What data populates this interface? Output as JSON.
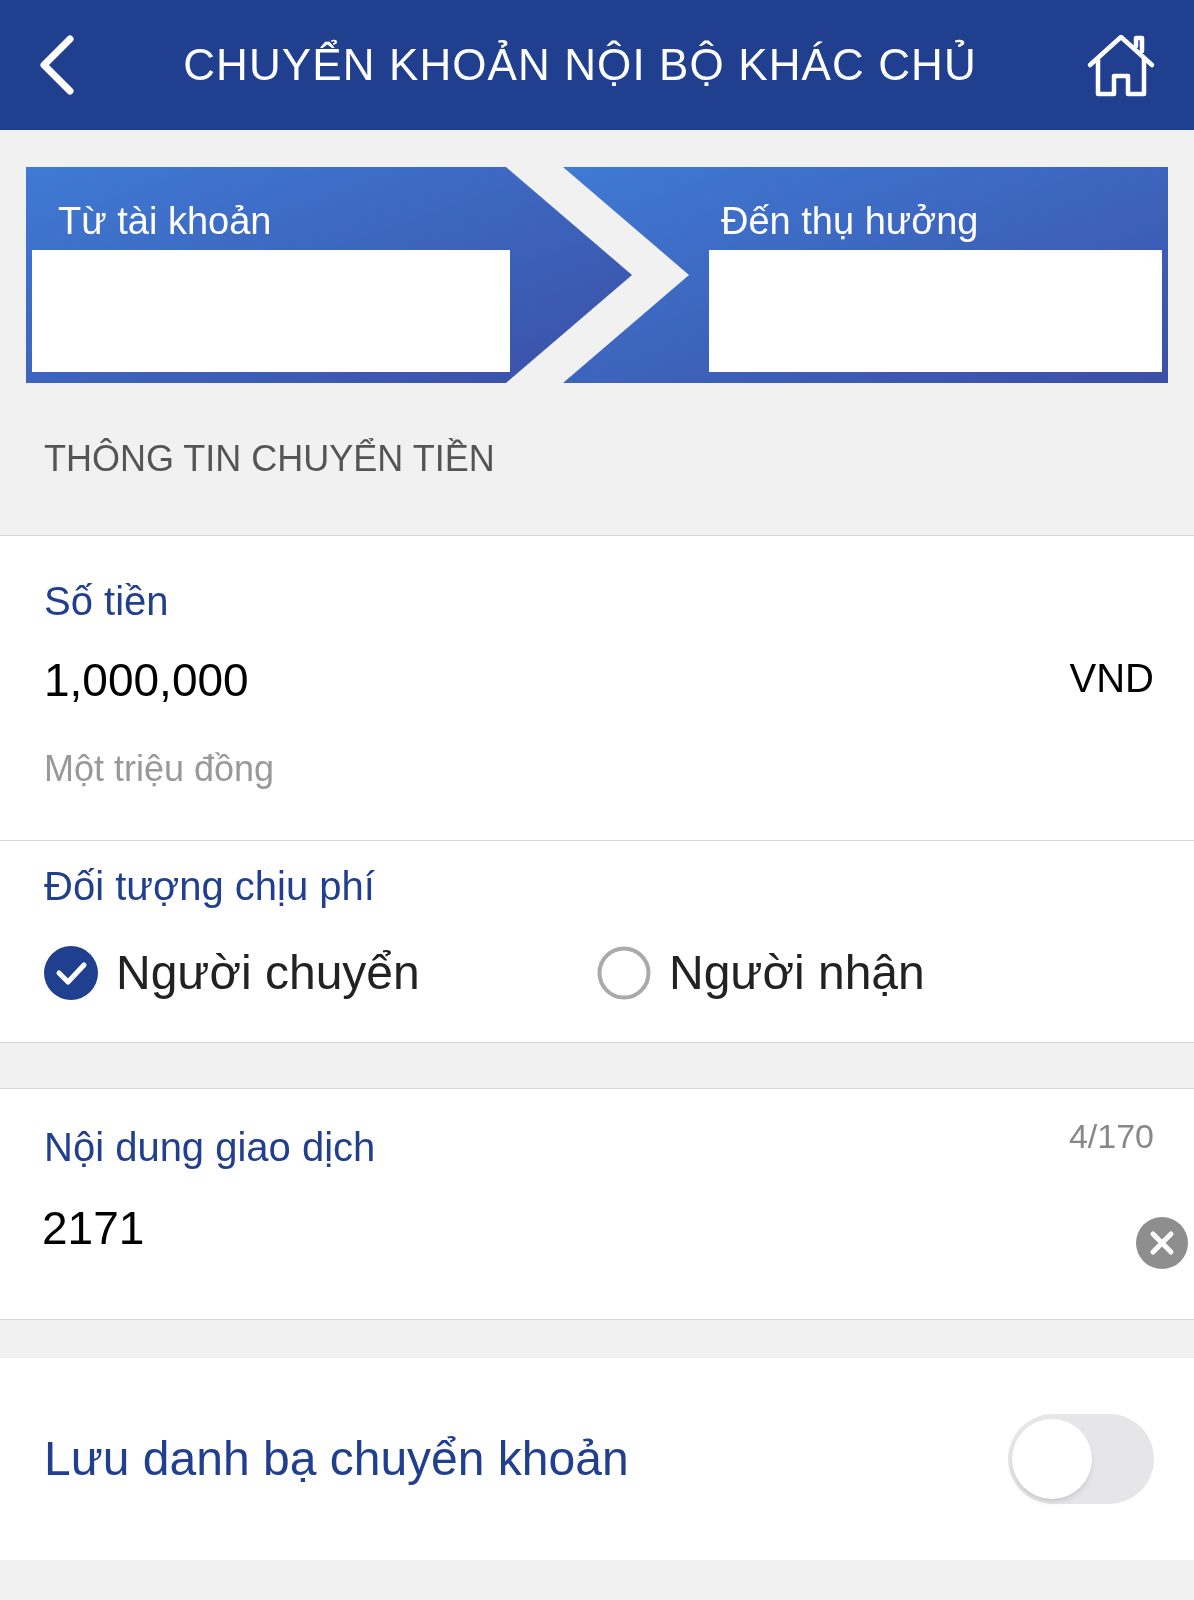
{
  "header": {
    "title": "CHUYỂN KHOẢN NỘI BỘ KHÁC CHỦ"
  },
  "accounts": [
    {
      "label": "Từ tài khoản"
    },
    {
      "label": "Đến thụ hưởng"
    }
  ],
  "section_title": "THÔNG TIN CHUYỂN TIỀN",
  "amount": {
    "label": "Số tiền",
    "value": "1,000,000",
    "currency": "VND",
    "in_words": "Một triệu đồng"
  },
  "fee": {
    "label": "Đối tượng chịu phí",
    "options": [
      {
        "label": "Người chuyển",
        "selected": true
      },
      {
        "label": "Người nhận",
        "selected": false
      }
    ]
  },
  "note": {
    "label": "Nội dung giao dịch",
    "counter": "4/170",
    "value": "2171"
  },
  "save_contact": {
    "label": "Lưu danh bạ chuyển khoản",
    "on": false
  }
}
